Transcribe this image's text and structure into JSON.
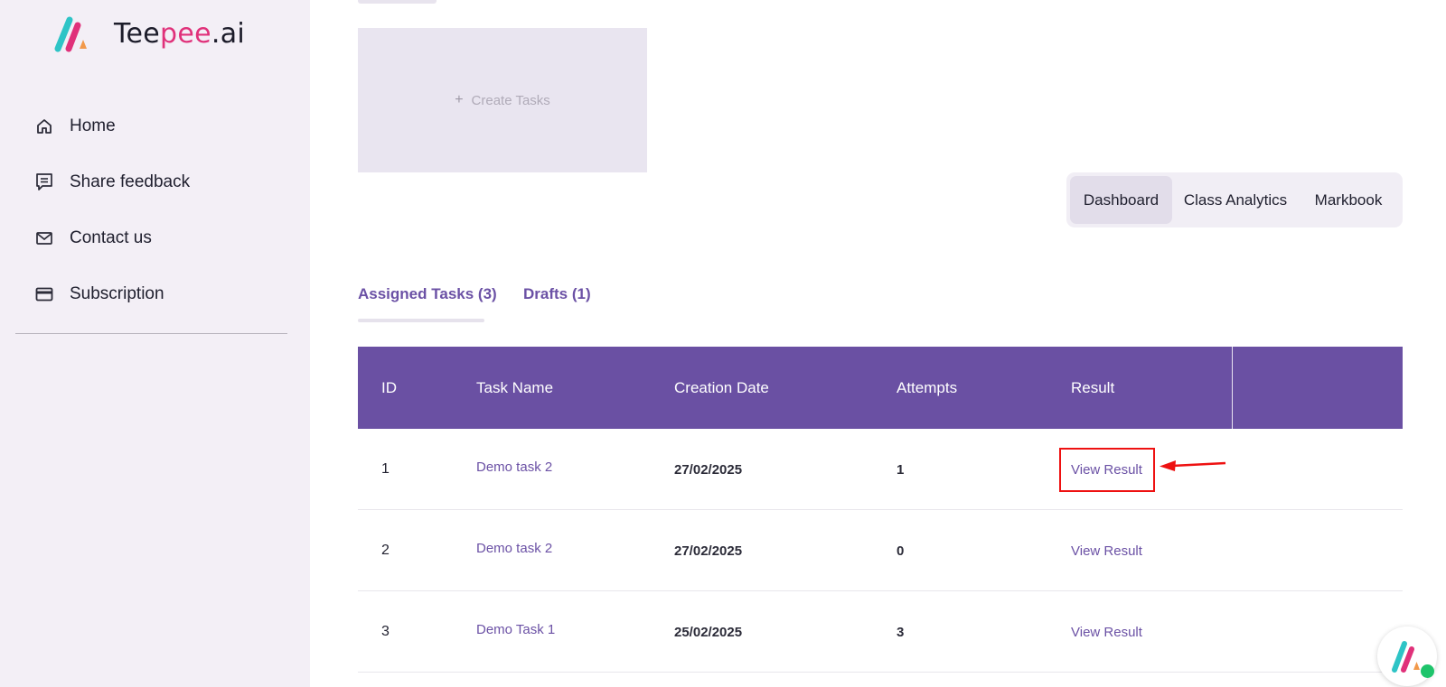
{
  "brand": {
    "name_start": "Tee",
    "name_mid": "pee",
    "name_end": ".ai",
    "colors": {
      "teal": "#2ec4c6",
      "pink": "#e0317a",
      "orange": "#f2994a"
    }
  },
  "sidebar": {
    "items": [
      {
        "label": "Home",
        "icon": "home-icon"
      },
      {
        "label": "Share feedback",
        "icon": "feedback-icon"
      },
      {
        "label": "Contact us",
        "icon": "mail-icon"
      },
      {
        "label": "Subscription",
        "icon": "credit-card-icon"
      }
    ]
  },
  "create_tasks": {
    "icon": "plus-icon",
    "label": "Create Tasks"
  },
  "view_switcher": {
    "options": [
      "Dashboard",
      "Class Analytics",
      "Markbook"
    ],
    "active": "Dashboard"
  },
  "tabs": [
    {
      "label": "Assigned Tasks (3)",
      "active": true
    },
    {
      "label": "Drafts (1)",
      "active": false
    }
  ],
  "table": {
    "headers": [
      "ID",
      "Task Name",
      "Creation Date",
      "Attempts",
      "Result"
    ],
    "rows": [
      {
        "id": "1",
        "name": "Demo task 2",
        "date": "27/02/2025",
        "attempts": "1",
        "result": "View Result"
      },
      {
        "id": "2",
        "name": "Demo task 2",
        "date": "27/02/2025",
        "attempts": "0",
        "result": "View Result"
      },
      {
        "id": "3",
        "name": "Demo Task 1",
        "date": "25/02/2025",
        "attempts": "3",
        "result": "View Result"
      }
    ]
  },
  "colors": {
    "header_purple": "#6a50a3",
    "link_purple": "#6b51a5",
    "sidebar_bg": "#f3eff6",
    "annotation_red": "#ee1111",
    "status_green": "#1ec46b"
  }
}
